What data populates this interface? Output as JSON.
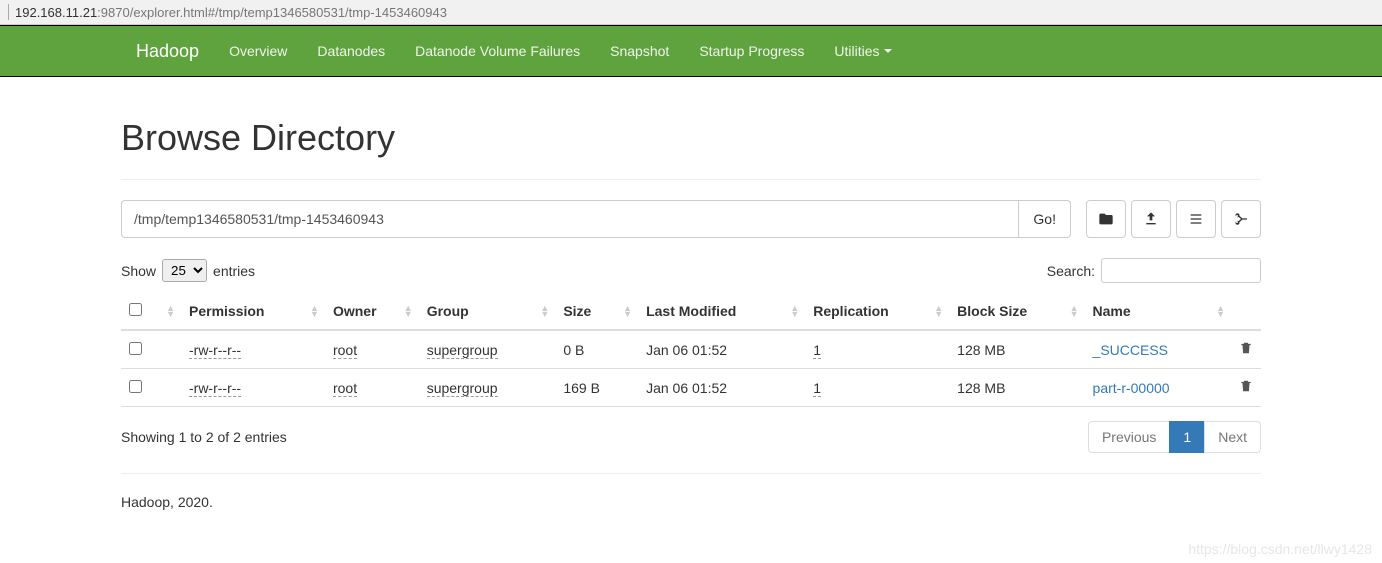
{
  "url": {
    "host": "192.168.11.21",
    "rest": ":9870/explorer.html#/tmp/temp1346580531/tmp-1453460943"
  },
  "nav": {
    "brand": "Hadoop",
    "items": [
      "Overview",
      "Datanodes",
      "Datanode Volume Failures",
      "Snapshot",
      "Startup Progress",
      "Utilities"
    ]
  },
  "page_title": "Browse Directory",
  "path_value": "/tmp/temp1346580531/tmp-1453460943",
  "go_label": "Go!",
  "show_label": "Show",
  "entries_label": "entries",
  "page_size": "25",
  "search_label": "Search:",
  "columns": [
    "",
    "",
    "Permission",
    "Owner",
    "Group",
    "Size",
    "Last Modified",
    "Replication",
    "Block Size",
    "Name",
    ""
  ],
  "rows": [
    {
      "permission": "-rw-r--r--",
      "owner": "root",
      "group": "supergroup",
      "size": "0 B",
      "modified": "Jan 06 01:52",
      "replication": "1",
      "block_size": "128 MB",
      "name": "_SUCCESS"
    },
    {
      "permission": "-rw-r--r--",
      "owner": "root",
      "group": "supergroup",
      "size": "169 B",
      "modified": "Jan 06 01:52",
      "replication": "1",
      "block_size": "128 MB",
      "name": "part-r-00000"
    }
  ],
  "info_text": "Showing 1 to 2 of 2 entries",
  "pagination": {
    "prev": "Previous",
    "page": "1",
    "next": "Next"
  },
  "footer": "Hadoop, 2020.",
  "watermark": "https://blog.csdn.net/llwy1428"
}
